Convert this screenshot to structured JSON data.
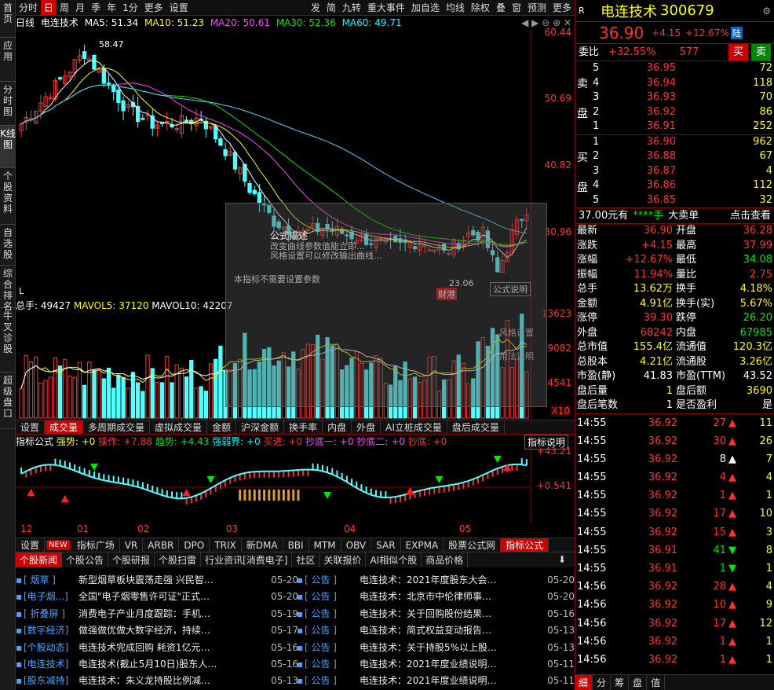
{
  "sidebar": [
    "首页",
    "应用",
    "分时图",
    "K线图",
    "个股资料",
    "自选股",
    "综合排名",
    "牛叉诊股",
    "超级盘口"
  ],
  "toolbar": {
    "left": [
      "分时",
      "日",
      "周",
      "月",
      "季",
      "年",
      "1分",
      "更多",
      "设置"
    ],
    "right": [
      "发",
      "简",
      "九转",
      "重大事件",
      "加自选",
      "均线",
      "除权",
      "叠",
      "窗",
      "预测",
      "更多"
    ]
  },
  "ma": {
    "label": "日线",
    "name": "电连技术",
    "ma5": "MA5: 51.34",
    "ma10": "MA10: 51.23",
    "ma20": "MA20: 50.61",
    "ma30": "MA30: 52.36",
    "ma60": "MA60: 49.71"
  },
  "price_axis": [
    "60.44",
    "50.69",
    "40.82",
    "30.96"
  ],
  "annotations": {
    "high": "58.47",
    "low": "23.06",
    "tag": "财港",
    "lbl_l": "L"
  },
  "vol": {
    "total": "总手: 49427",
    "mavol5": "MAVOL5: 37120",
    "mavol10": "MAVOL10: 42207",
    "axis": [
      "13623",
      "9082",
      "4541"
    ],
    "unit": "X10"
  },
  "vol_tabs": [
    "设置",
    "成交量",
    "多周期成交量",
    "虚拟成交量",
    "金额",
    "沪深金额",
    "换手率",
    "内盘",
    "外盘",
    "AI立桩成交量",
    "盘后成交量"
  ],
  "indicator": {
    "name": "指标公式",
    "qiangshi": "强势: +0",
    "caozuo": "操作: +7.88",
    "qushi": "趋势: +4.43",
    "qiangruo": "强弱界: +0",
    "maijin": "买进: +0",
    "chaodi1": "抄底一: +0",
    "chaodi2": "抄底二: +0",
    "chaodi": "抄底: +0",
    "explain": "指标说明",
    "axis": [
      "+43.21",
      "+0.541"
    ]
  },
  "months": [
    "12",
    "01",
    "02",
    "03",
    "04",
    "05"
  ],
  "ind_tabs": [
    "设置",
    "NEW",
    "指标广场",
    "VR",
    "ARBR",
    "DPO",
    "TRIX",
    "新DMA",
    "BBI",
    "MTM",
    "OBV",
    "SAR",
    "EXPMA",
    "股票公式网",
    "指标公式"
  ],
  "news_tabs": [
    "个股新闻",
    "个股公告",
    "个股研报",
    "个股扫雷",
    "行业资讯[消费电子]",
    "社区",
    "关联报价",
    "AI相似个股",
    "商品价格"
  ],
  "news_left": [
    {
      "src": "[ 烟草 ]",
      "title": "新型烟草板块震荡走强 兴民智…",
      "date": "05-20"
    },
    {
      "src": "[电子烟...]",
      "title": "全国\"电子烟零售许可证\"正式…",
      "date": "05-20"
    },
    {
      "src": "[ 折叠屏 ]",
      "title": "消费电子产业月度跟踪：手机…",
      "date": "05-19"
    },
    {
      "src": "[数字经济]",
      "title": "做强做优做大数字经济，持续…",
      "date": "05-17"
    },
    {
      "src": "[个股动态]",
      "title": "电连技术完成回购 耗资1亿元…",
      "date": "05-16"
    },
    {
      "src": "[电连技术]",
      "title": "电连技术(截止5月10日)股东人…",
      "date": "05-16"
    },
    {
      "src": "[股东减持]",
      "title": "电连技术：朱义龙持股比例减…",
      "date": "05-13"
    }
  ],
  "news_right": [
    {
      "src": "[ 公告 ]",
      "title": "电连技术：2021年度股东大会…",
      "date": "05-20"
    },
    {
      "src": "[ 公告 ]",
      "title": "电连技术：北京市中伦律师事…",
      "date": "05-20"
    },
    {
      "src": "[ 公告 ]",
      "title": "电连技术：关于回购股份结果…",
      "date": "05-16"
    },
    {
      "src": "[ 公告 ]",
      "title": "电连技术：简式权益变动报告…",
      "date": "05-13"
    },
    {
      "src": "[ 公告 ]",
      "title": "电连技术：关于持股5%以上股…",
      "date": "05-13"
    },
    {
      "src": "[ 公告 ]",
      "title": "电连技术：2021年度业绩说明…",
      "date": "05-11"
    },
    {
      "src": "[ 公告 ]",
      "title": "电连技术：2021年度业绩说明…",
      "date": "05-11"
    }
  ],
  "quote": {
    "r": "R",
    "name": "电连技术",
    "code": "300679",
    "price": "36.90",
    "change": "+4.15",
    "pct": "+12.67%",
    "tag": "陆",
    "weibi_lbl": "委比",
    "weibi": "+32.55%",
    "weicha": "577",
    "sell_btn": "买",
    "buy_btn": "卖"
  },
  "asks": [
    {
      "n": "5",
      "p": "36.95",
      "v": "72"
    },
    {
      "n": "4",
      "p": "36.94",
      "v": "118"
    },
    {
      "n": "3",
      "p": "36.93",
      "v": "70"
    },
    {
      "n": "2",
      "p": "36.92",
      "v": "86"
    },
    {
      "n": "1",
      "p": "36.91",
      "v": "252"
    }
  ],
  "bids": [
    {
      "n": "1",
      "p": "36.90",
      "v": "962"
    },
    {
      "n": "2",
      "p": "36.88",
      "v": "67"
    },
    {
      "n": "3",
      "p": "36.87",
      "v": "4"
    },
    {
      "n": "4",
      "p": "36.86",
      "v": "112"
    },
    {
      "n": "5",
      "p": "36.85",
      "v": "32"
    }
  ],
  "ask_lbl": [
    "卖",
    "盘"
  ],
  "bid_lbl": [
    "买",
    "盘"
  ],
  "big_order": {
    "price": "37.00元有",
    "stars": "****手",
    "label": "大卖单",
    "link": "点击查看"
  },
  "stats": [
    [
      "最新",
      "36.90",
      "开盘",
      "36.28"
    ],
    [
      "涨跌",
      "+4.15",
      "最高",
      "37.99"
    ],
    [
      "涨幅",
      "+12.67%",
      "最低",
      "34.08"
    ],
    [
      "振幅",
      "11.94%",
      "量比",
      "2.75"
    ],
    [
      "总手",
      "13.62万",
      "换手",
      "4.18%"
    ],
    [
      "金额",
      "4.91亿",
      "换手(实)",
      "5.67%"
    ],
    [
      "涨停",
      "39.30",
      "跌停",
      "26.20"
    ],
    [
      "外盘",
      "68242",
      "内盘",
      "67985"
    ],
    [
      "总市值",
      "155.4亿",
      "流通值",
      "120.3亿"
    ],
    [
      "总股本",
      "4.21亿",
      "流通股",
      "3.26亿"
    ],
    [
      "市盈(静)",
      "41.83",
      "市盈(TTM)",
      "43.52"
    ],
    [
      "盘后量",
      "1",
      "盘后额",
      "3690"
    ],
    [
      "盘后笔数",
      "1",
      "是否盈利",
      "是"
    ]
  ],
  "ticks": [
    {
      "t": "14:55",
      "p": "36.92",
      "v": "27",
      "d": "up",
      "n": "11"
    },
    {
      "t": "14:55",
      "p": "36.92",
      "v": "30",
      "d": "up",
      "n": "26"
    },
    {
      "t": "14:55",
      "p": "36.92",
      "v": "8",
      "d": "wup",
      "n": "7"
    },
    {
      "t": "14:55",
      "p": "36.92",
      "v": "4",
      "d": "up",
      "n": "4"
    },
    {
      "t": "14:55",
      "p": "36.92",
      "v": "1",
      "d": "up",
      "n": "1"
    },
    {
      "t": "14:55",
      "p": "36.92",
      "v": "17",
      "d": "up",
      "n": "10"
    },
    {
      "t": "14:55",
      "p": "36.92",
      "v": "15",
      "d": "up",
      "n": "3"
    },
    {
      "t": "14:55",
      "p": "36.91",
      "v": "41",
      "d": "down",
      "n": "8"
    },
    {
      "t": "14:55",
      "p": "36.91",
      "v": "1",
      "d": "down",
      "n": "1"
    },
    {
      "t": "14:56",
      "p": "36.92",
      "v": "28",
      "d": "up",
      "n": "4"
    },
    {
      "t": "14:56",
      "p": "36.92",
      "v": "10",
      "d": "up",
      "n": "9"
    },
    {
      "t": "14:56",
      "p": "36.92",
      "v": "17",
      "d": "up",
      "n": "12"
    },
    {
      "t": "14:56",
      "p": "36.92",
      "v": "1",
      "d": "up",
      "n": "1"
    },
    {
      "t": "14:56",
      "p": "36.92",
      "v": "1",
      "d": "up",
      "n": "1"
    }
  ],
  "bottom_tabs": [
    "细",
    "分",
    "筹",
    "盘",
    "值"
  ],
  "dialog": {
    "title": "公式描述",
    "l1": "改变曲线参数值能立即…",
    "l2": "风格设置可以修改输出曲线…",
    "note": "本指标不需要设置参数",
    "b1": "公式说明",
    "b2": "风格设置",
    "b3": "用法说明"
  }
}
